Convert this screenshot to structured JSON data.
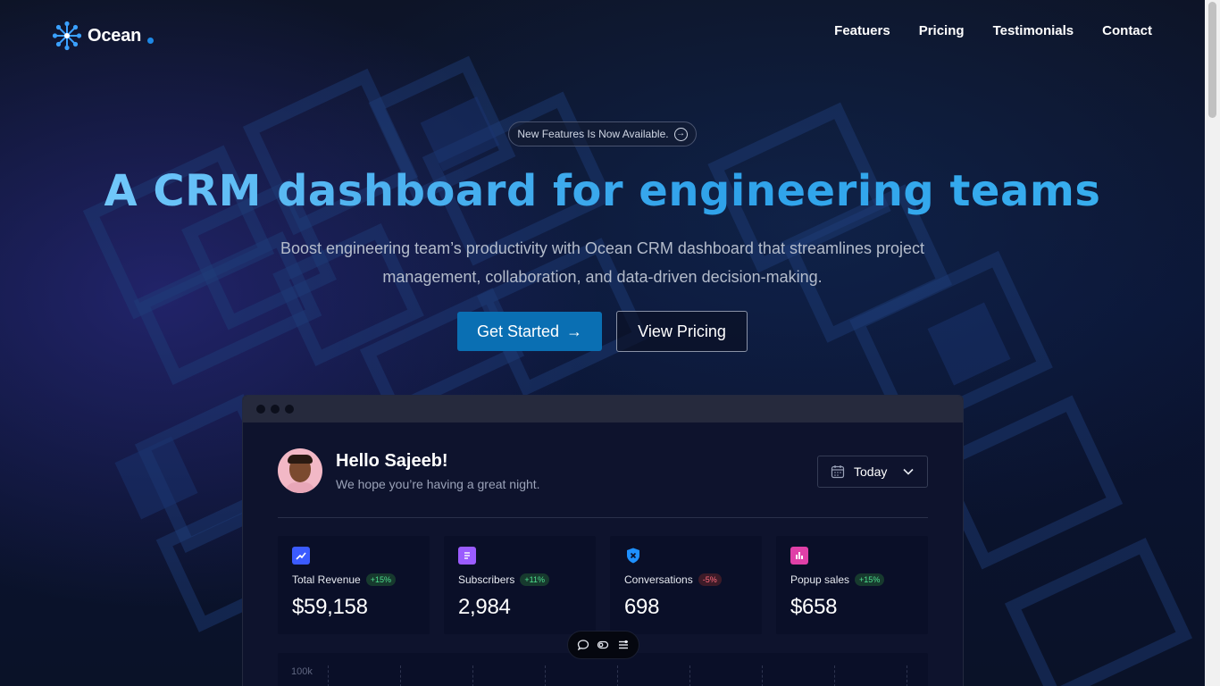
{
  "nav": {
    "logo_text": "Ocean",
    "links": [
      "Featuers",
      "Pricing",
      "Testimonials",
      "Contact"
    ]
  },
  "hero": {
    "badge": "New Features Is Now Available.",
    "headline": "A CRM dashboard for engineering teams",
    "subtext": "Boost engineering team’s productivity with Ocean CRM dashboard that streamlines project management, collaboration, and data-driven decision-making.",
    "primary_button": "Get Started",
    "secondary_button": "View Pricing"
  },
  "dashboard": {
    "greeting_title": "Hello Sajeeb!",
    "greeting_sub": "We hope you’re having a great night.",
    "date_filter": "Today",
    "stats": [
      {
        "label": "Total Revenue",
        "change": "+15%",
        "value": "$59,158",
        "trend": "up",
        "icon": "chart-line-icon",
        "color": "#3b5bff"
      },
      {
        "label": "Subscribers",
        "change": "+11%",
        "value": "2,984",
        "trend": "up",
        "icon": "document-icon",
        "color": "#9b5cff"
      },
      {
        "label": "Conversations",
        "change": "-5%",
        "value": "698",
        "trend": "down",
        "icon": "shield-icon",
        "color": "#1e90ff"
      },
      {
        "label": "Popup sales",
        "change": "+15%",
        "value": "$658",
        "trend": "up",
        "icon": "bar-chart-icon",
        "color": "#e040a8"
      }
    ],
    "chart_ylabel": "100k"
  },
  "colors": {
    "accent": "#0a6fb3",
    "background": "#0b1124",
    "headline_gradient_start": "#7fd0ff",
    "headline_gradient_end": "#2fa2ea"
  }
}
